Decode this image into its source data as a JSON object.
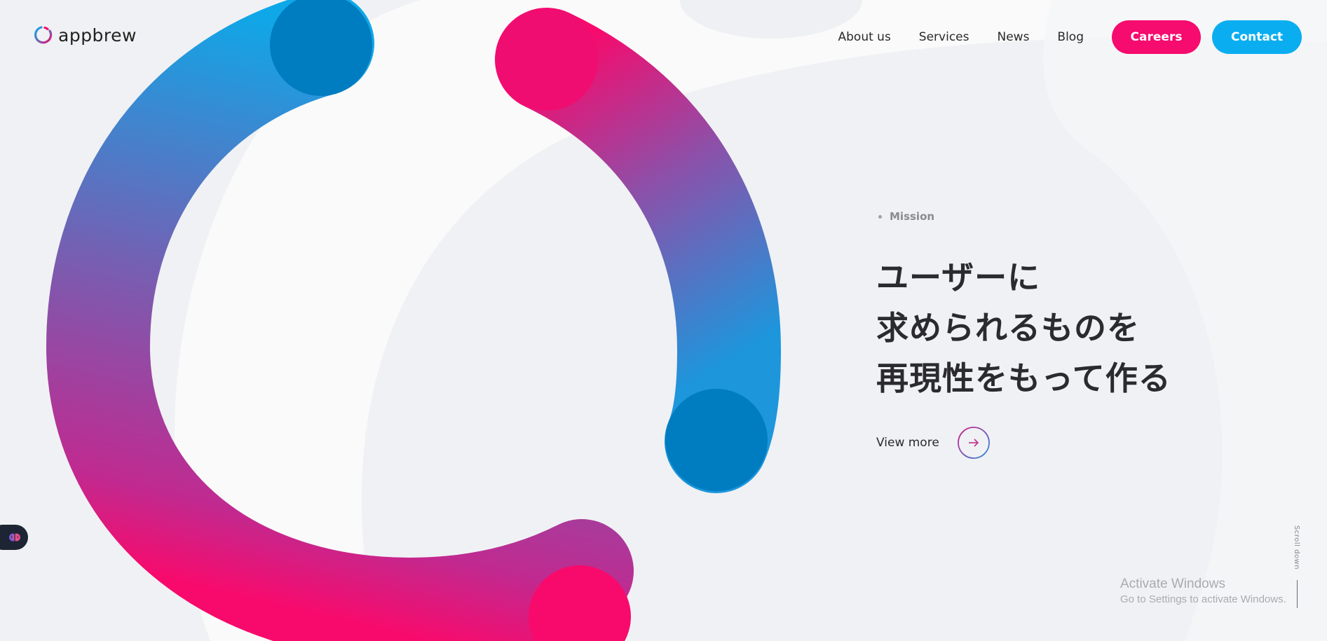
{
  "brand": {
    "name": "appbrew",
    "colors": {
      "pink": "#f60b6e",
      "blue": "#0aaef0",
      "dark_blue": "#007cc0",
      "purple": "#8e4fa8",
      "text": "#2b2b2e"
    }
  },
  "nav": {
    "links": [
      "About us",
      "Services",
      "News",
      "Blog"
    ],
    "careers_label": "Careers",
    "contact_label": "Contact"
  },
  "hero": {
    "section_label": "Mission",
    "headline_lines": [
      "ユーザーに",
      "求められるものを",
      "再現性をもって作る"
    ],
    "view_more_label": "View more"
  },
  "scroll": {
    "label": "Scroll down"
  },
  "watermark": {
    "title": "Activate Windows",
    "subtitle": "Go to Settings to activate Windows."
  },
  "icons": {
    "logo": "appbrew-ring-logo-icon",
    "arrow": "arrow-right-icon",
    "side_widget": "brain-icon"
  }
}
